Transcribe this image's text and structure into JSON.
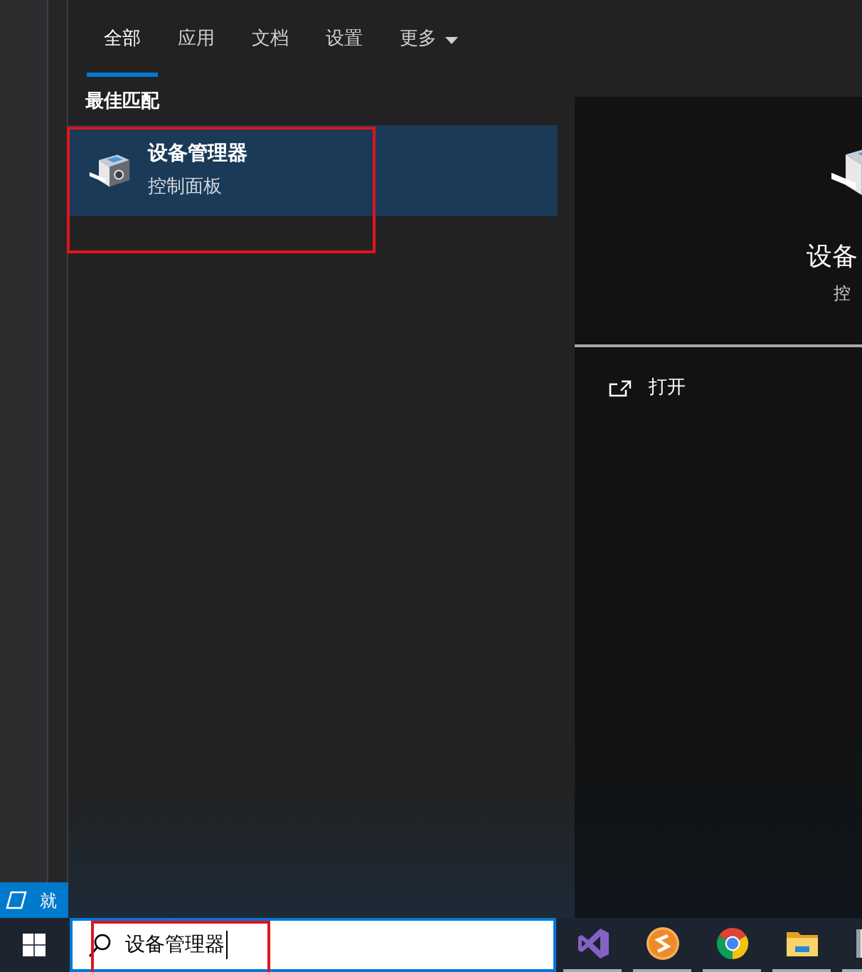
{
  "background_window": {
    "status_text": "就"
  },
  "search_panel": {
    "tabs": [
      {
        "label": "全部",
        "selected": true,
        "kind": "tab"
      },
      {
        "label": "应用",
        "selected": false,
        "kind": "tab"
      },
      {
        "label": "文档",
        "selected": false,
        "kind": "tab"
      },
      {
        "label": "设置",
        "selected": false,
        "kind": "tab"
      },
      {
        "label": "更多",
        "selected": false,
        "kind": "dropdown"
      }
    ],
    "section_title": "最佳匹配",
    "results": [
      {
        "title": "设备管理器",
        "subtitle": "控制面板",
        "selected": true,
        "highlighted": true
      }
    ]
  },
  "preview": {
    "title": "设备",
    "subtitle": "控",
    "actions": [
      {
        "label": "打开"
      }
    ]
  },
  "taskbar": {
    "search": {
      "value": "设备管理器",
      "focused": true,
      "highlighted": true
    },
    "apps": [
      {
        "kind": "ribbon-logo",
        "running": true
      },
      {
        "kind": "zigzag-circle",
        "running": true
      },
      {
        "kind": "segmented-circle",
        "running": true
      },
      {
        "kind": "folder",
        "running": true
      },
      {
        "kind": "generic",
        "running": true
      }
    ]
  }
}
